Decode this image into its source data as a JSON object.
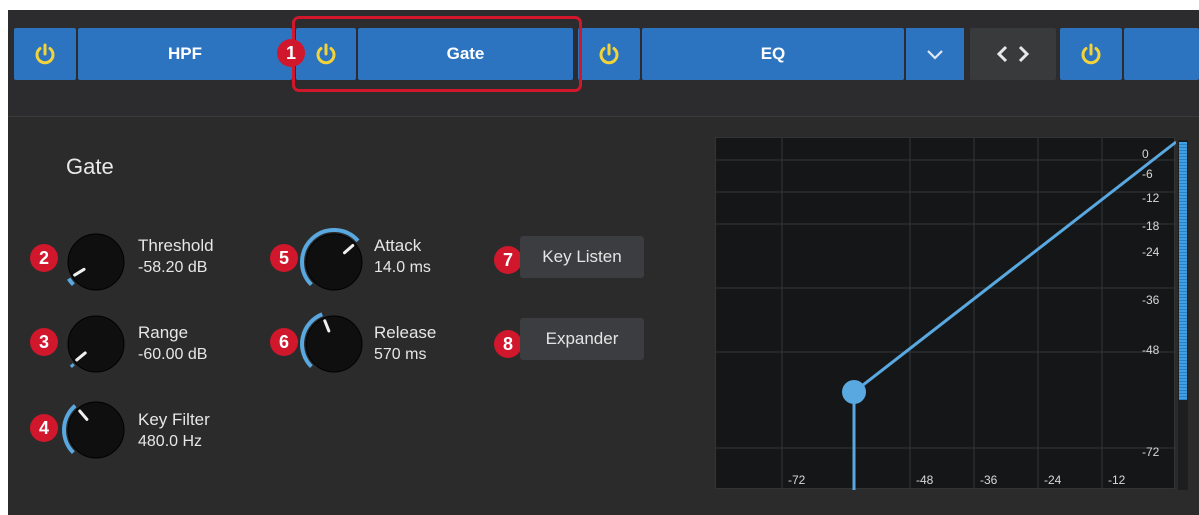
{
  "tabs": {
    "hpf_label": "HPF",
    "gate_label": "Gate",
    "eq_label": "EQ"
  },
  "section": {
    "title": "Gate"
  },
  "knobs": [
    {
      "name": "Threshold",
      "value": "-58.20 dB",
      "level": 0.05
    },
    {
      "name": "Range",
      "value": "-60.00 dB",
      "level": 0.02
    },
    {
      "name": "Key Filter",
      "value": "480.0 Hz",
      "level": 0.35
    },
    {
      "name": "Attack",
      "value": "14.0 ms",
      "level": 0.68
    },
    {
      "name": "Release",
      "value": "570 ms",
      "level": 0.42
    }
  ],
  "buttons": {
    "key_listen": "Key Listen",
    "expander": "Expander"
  },
  "badges": [
    "1",
    "2",
    "3",
    "4",
    "5",
    "6",
    "7",
    "8"
  ],
  "graph": {
    "y_ticks": [
      "0",
      "-6",
      "-12",
      "-18",
      "-24",
      "-36",
      "-48",
      "-72"
    ],
    "x_ticks": [
      "-72",
      "-48",
      "-36",
      "-24",
      "-12"
    ]
  },
  "colors": {
    "accent": "#2c74c0",
    "power": "#f2d33a",
    "highlight": "#d0172c",
    "curve": "#5aa8e0"
  }
}
